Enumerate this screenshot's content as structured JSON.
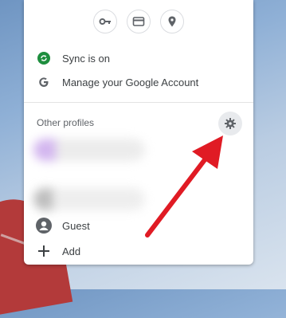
{
  "quick_actions": [
    {
      "icon": "key-icon"
    },
    {
      "icon": "credit-card-icon"
    },
    {
      "icon": "location-pin-icon"
    }
  ],
  "sync": {
    "label": "Sync is on",
    "color": "#1e8e3e"
  },
  "manage_account": {
    "label": "Manage your Google Account"
  },
  "other_profiles": {
    "label": "Other profiles"
  },
  "profiles": [
    {
      "label": "",
      "avatar_color": "#c9a5e8"
    },
    {
      "label": "",
      "avatar_color": "#9e9e9e"
    }
  ],
  "guest": {
    "label": "Guest"
  },
  "add": {
    "label": "Add"
  },
  "colors": {
    "accent_arrow": "#e01b24",
    "text": "#3c4043"
  }
}
